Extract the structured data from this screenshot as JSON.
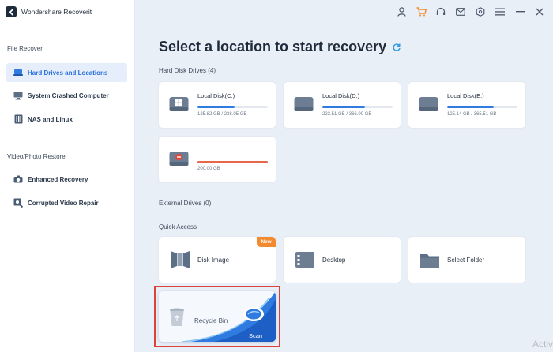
{
  "app": {
    "title": "Wondershare Recoverit"
  },
  "sidebar": {
    "sections": [
      {
        "label": "File Recover",
        "items": [
          {
            "label": "Hard Drives and Locations",
            "icon": "hard-drive-icon",
            "active": true
          },
          {
            "label": "System Crashed Computer",
            "icon": "monitor-icon",
            "active": false
          },
          {
            "label": "NAS and Linux",
            "icon": "nas-icon",
            "active": false
          }
        ]
      },
      {
        "label": "Video/Photo Restore",
        "items": [
          {
            "label": "Enhanced Recovery",
            "icon": "camera-icon",
            "active": false
          },
          {
            "label": "Corrupted Video Repair",
            "icon": "video-repair-icon",
            "active": false
          }
        ]
      }
    ]
  },
  "topbar": {
    "icons": [
      "user-icon",
      "cart-icon",
      "headset-icon",
      "mail-icon",
      "badge-icon",
      "menu-icon",
      "minimize-icon",
      "close-icon"
    ]
  },
  "main": {
    "title": "Select a location to start recovery",
    "hard_disk_label": "Hard Disk Drives (4)",
    "drives": [
      {
        "name": "Local Disk(C:)",
        "size": "125.82 GB / 238.05 GB",
        "used_fraction": 0.53,
        "bar_color": "#2f7be0"
      },
      {
        "name": "Local Disk(D:)",
        "size": "223.51 GB / 366.00 GB",
        "used_fraction": 0.61,
        "bar_color": "#2f7be0"
      },
      {
        "name": "Local Disk(E:)",
        "size": "125.14 GB / 365.51 GB",
        "used_fraction": 0.66,
        "bar_color": "#2f7be0"
      },
      {
        "name": "",
        "size": "200.00 GB",
        "used_fraction": 1.0,
        "bar_color": "#e8674a"
      }
    ],
    "external_label": "External Drives (0)",
    "quick_access_label": "Quick Access",
    "quick_access": [
      {
        "label": "Disk Image",
        "icon": "disk-image-icon",
        "badge": "New"
      },
      {
        "label": "Desktop",
        "icon": "desktop-icon",
        "badge": ""
      },
      {
        "label": "Select Folder",
        "icon": "folder-icon",
        "badge": ""
      }
    ],
    "recycle_bin": {
      "label": "Recycle Bin",
      "scan_label": "Scan"
    }
  },
  "watermark": "Activ",
  "colors": {
    "accent": "#2f7be0",
    "highlight_border": "#d8443a",
    "badge": "#f28a30"
  }
}
